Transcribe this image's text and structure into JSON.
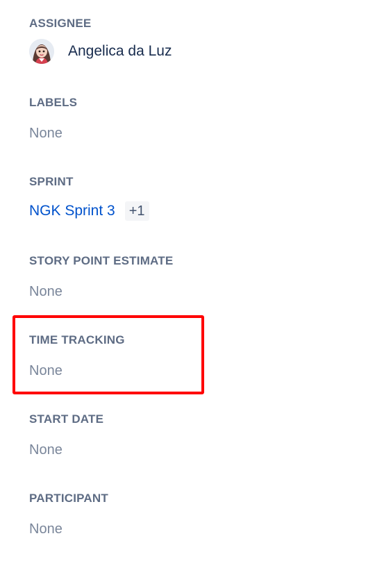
{
  "fields": {
    "assignee": {
      "label": "ASSIGNEE",
      "name": "Angelica da Luz"
    },
    "labels": {
      "label": "LABELS",
      "value": "None"
    },
    "sprint": {
      "label": "SPRINT",
      "value": "NGK Sprint 3",
      "extra_count": "+1"
    },
    "story_point_estimate": {
      "label": "STORY POINT ESTIMATE",
      "value": "None"
    },
    "time_tracking": {
      "label": "TIME TRACKING",
      "value": "None"
    },
    "start_date": {
      "label": "START DATE",
      "value": "None"
    },
    "participant": {
      "label": "PARTICIPANT",
      "value": "None"
    }
  },
  "icons": {
    "assignee_avatar": "user-avatar"
  },
  "colors": {
    "label": "#5e6c84",
    "placeholder": "#7a869a",
    "link": "#0052cc",
    "highlight": "#ff0000"
  }
}
